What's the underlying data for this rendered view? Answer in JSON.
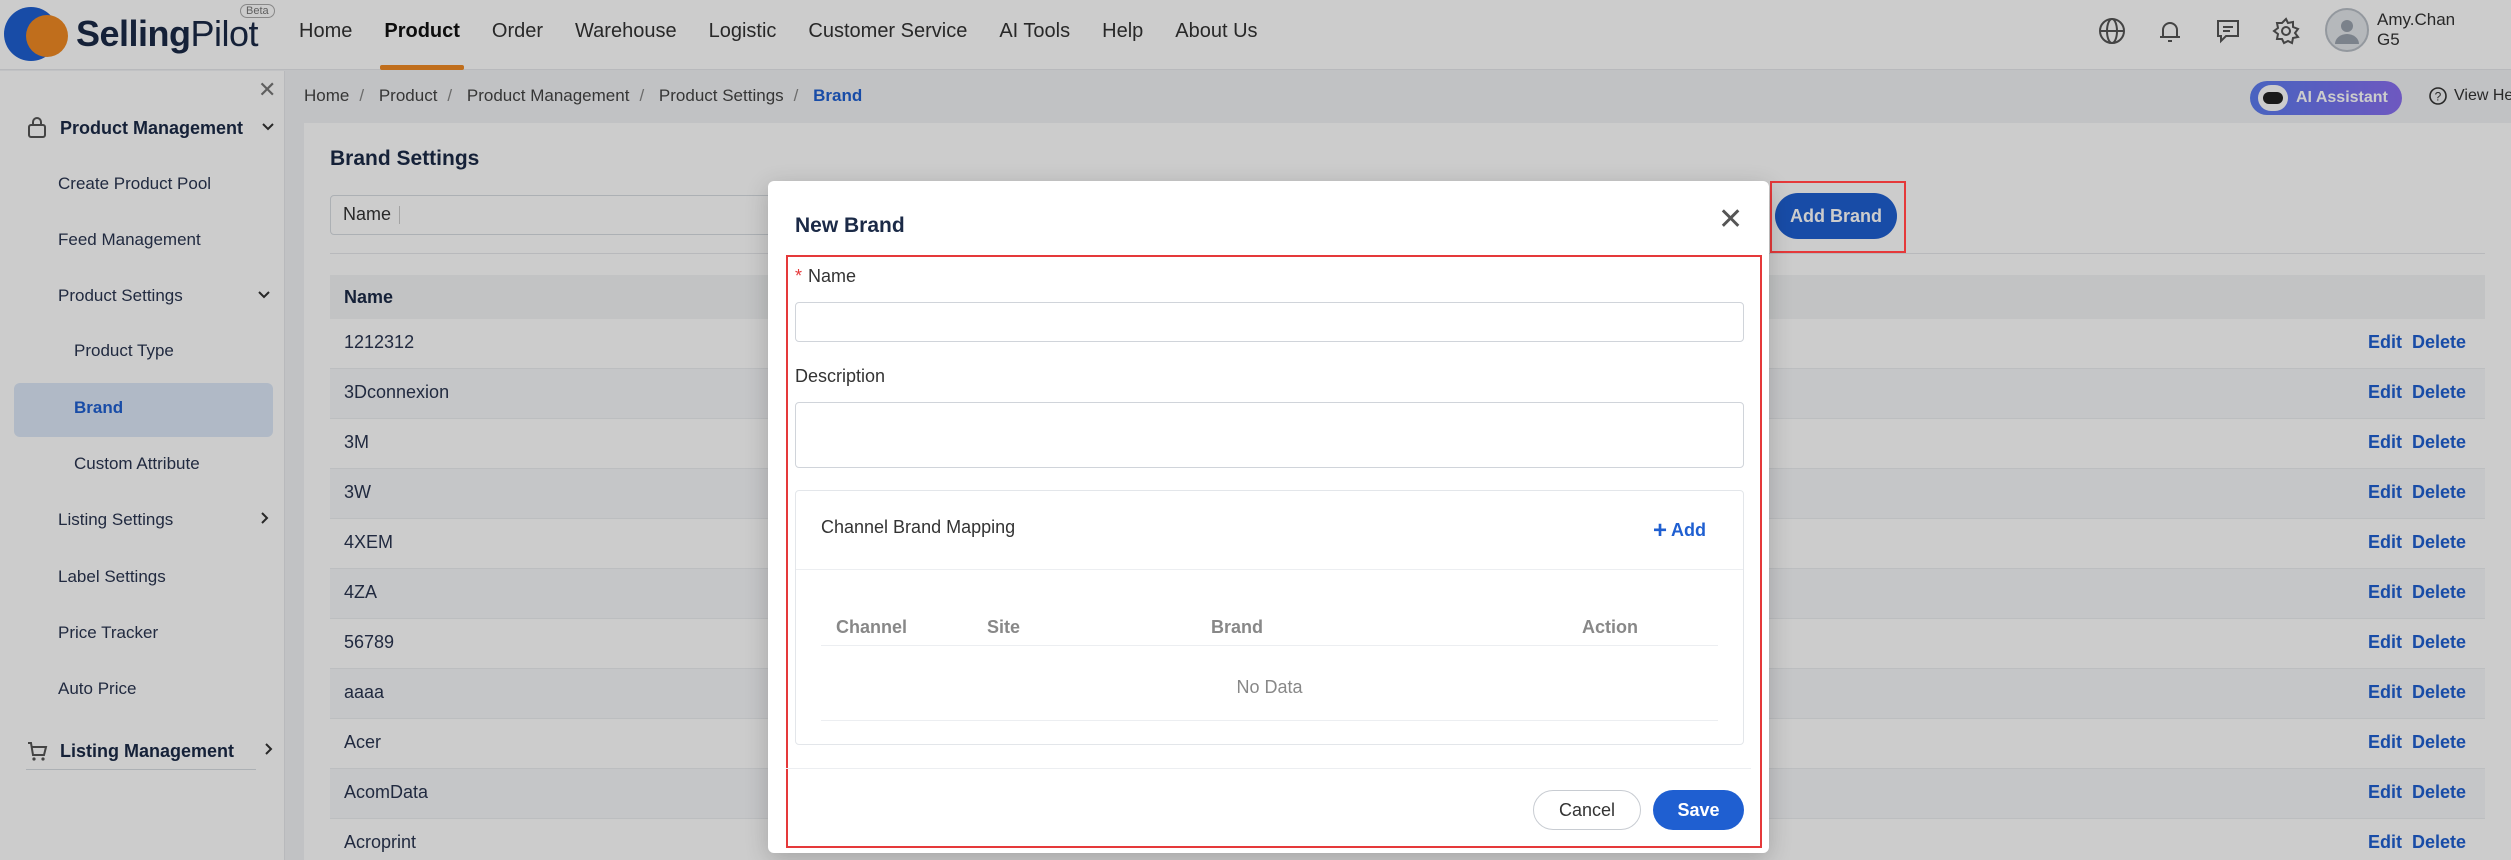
{
  "app": {
    "logo_bold": "Selling",
    "logo_light": "Pilot",
    "beta": "Beta"
  },
  "nav": [
    {
      "label": "Home"
    },
    {
      "label": "Product"
    },
    {
      "label": "Order"
    },
    {
      "label": "Warehouse"
    },
    {
      "label": "Logistic"
    },
    {
      "label": "Customer Service"
    },
    {
      "label": "AI Tools"
    },
    {
      "label": "Help"
    },
    {
      "label": "About Us"
    }
  ],
  "active_nav": "Product",
  "user": {
    "name": "Amy.Chan",
    "org": "G5"
  },
  "sidebar": {
    "group1": "Product Management",
    "items": [
      "Create Product Pool",
      "Feed Management",
      "Product Settings",
      "Product Type",
      "Brand",
      "Custom Attribute",
      "Listing Settings",
      "Label Settings",
      "Price Tracker",
      "Auto Price"
    ],
    "group2": "Listing Management"
  },
  "breadcrumb": [
    "Home",
    "Product",
    "Product Management",
    "Product Settings",
    "Brand"
  ],
  "ai_assistant": "AI Assistant",
  "view_help": "View He",
  "page": {
    "title": "Brand Settings",
    "filter_label": "Name",
    "add_button": "Add Brand",
    "column_name": "Name",
    "edit_label": "Edit",
    "delete_label": "Delete",
    "rows": [
      "1212312",
      "3Dconnexion",
      "3M",
      "3W",
      "4XEM",
      "4ZA",
      "56789",
      "aaaa",
      "Acer",
      "AcomData",
      "Acroprint"
    ]
  },
  "modal": {
    "title": "New Brand",
    "name_label": "Name",
    "required_mark": "*",
    "description_label": "Description",
    "mapping_title": "Channel Brand Mapping",
    "mapping_add": "Add",
    "columns": [
      "Channel",
      "Site",
      "Brand",
      "Action"
    ],
    "empty": "No Data",
    "cancel": "Cancel",
    "save": "Save"
  },
  "colors": {
    "primary": "#1f5fd1",
    "accent": "#f08a24",
    "highlight": "#e5393a"
  }
}
